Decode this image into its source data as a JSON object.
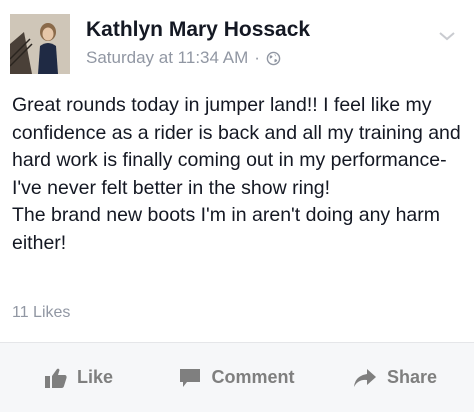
{
  "post": {
    "author": "Kathlyn Mary Hossack",
    "timestamp": "Saturday at 11:34 AM",
    "separator": "·",
    "privacy_icon": "globe-icon",
    "menu_icon": "chevron-down-icon",
    "paragraphs": [
      "Great rounds today in jumper land!! I feel like my confidence as a rider is back and all my training and hard work is finally coming out in my performance- I've never felt better in the show ring!",
      "The brand new boots I'm in aren't doing any harm either!"
    ],
    "likes": "11 Likes"
  },
  "actions": {
    "like": "Like",
    "comment": "Comment",
    "share": "Share"
  },
  "colors": {
    "text": "#141823",
    "meta": "#9197a3",
    "action": "#7f7f7f",
    "action_bar": "#f6f7f9"
  }
}
